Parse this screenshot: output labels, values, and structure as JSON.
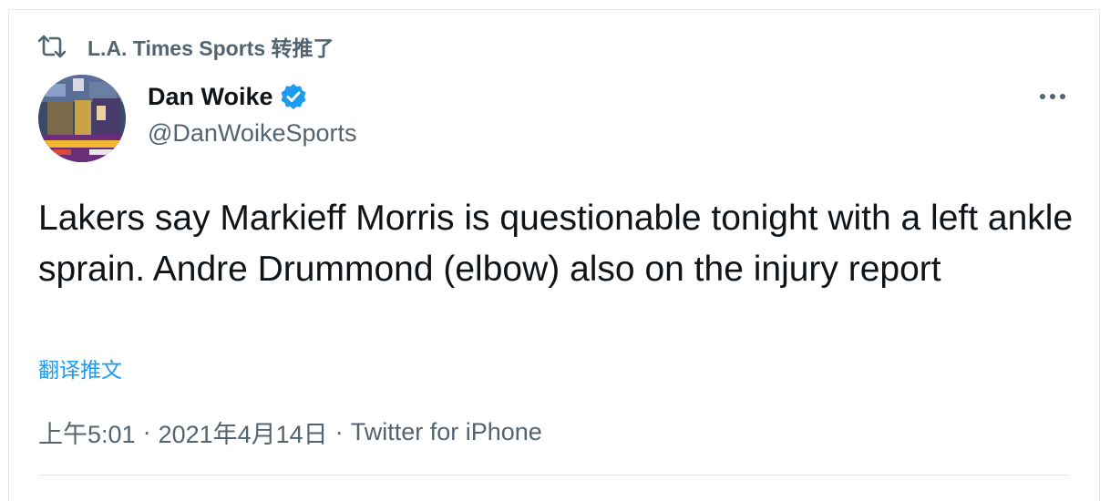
{
  "retweet": {
    "icon": "retweet-icon",
    "text": "L.A. Times Sports 转推了"
  },
  "author": {
    "name": "Dan Woike",
    "handle": "@DanWoikeSports",
    "verified_icon": "verified-badge-icon",
    "avatar_icon": "avatar"
  },
  "more_icon": "more-options-icon",
  "tweet": {
    "text": "Lakers say Markieff Morris is questionable tonight with a left ankle sprain. Andre Drummond (elbow) also on the injury report",
    "translate_label": "翻译推文"
  },
  "meta": {
    "time": "上午5:01",
    "separator": "·",
    "date": "2021年4月14日",
    "source": "Twitter for iPhone"
  },
  "colors": {
    "accent": "#1d9bf0",
    "muted": "#536471",
    "text": "#0f1419"
  }
}
